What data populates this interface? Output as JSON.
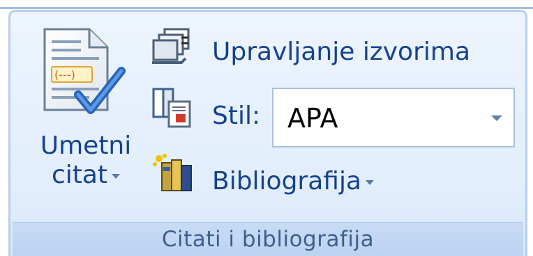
{
  "ribbon_group": {
    "label": "Citati i bibliografija",
    "insert_citation": {
      "line1": "Umetni",
      "line2": "citat"
    },
    "manage_sources": {
      "label": "Upravljanje izvorima"
    },
    "style": {
      "label": "Stil:",
      "value": "APA"
    },
    "bibliography": {
      "label": "Bibliografija"
    }
  },
  "colors": {
    "label_text": "#15428b",
    "group_label_text": "#3e5f8c",
    "group_border": "#b7cfeb",
    "group_background": "#e2eefc"
  },
  "icons": {
    "insert_citation": "document-with-checkmark-icon",
    "manage_sources": "stacked-documents-icon",
    "style": "document-style-icon",
    "bibliography": "books-icon"
  }
}
